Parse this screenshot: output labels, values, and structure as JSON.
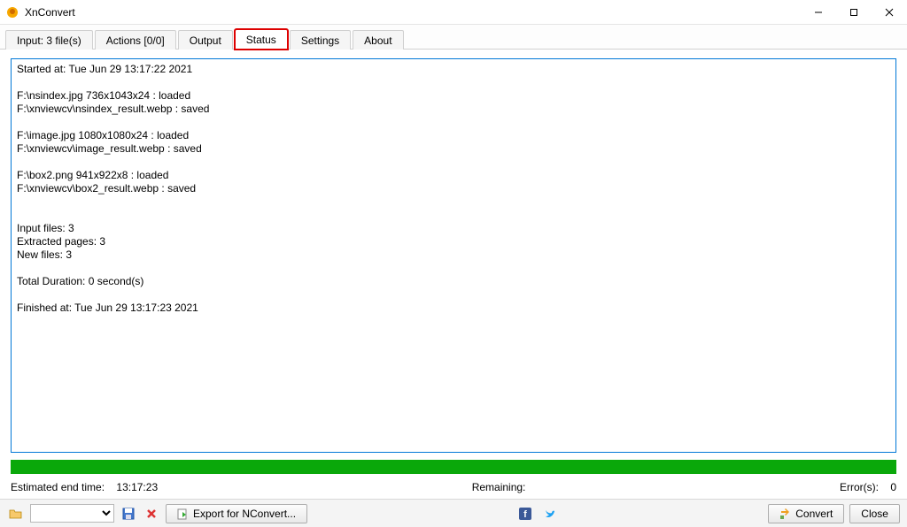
{
  "window": {
    "title": "XnConvert"
  },
  "tabs": {
    "input": "Input: 3 file(s)",
    "actions": "Actions [0/0]",
    "output": "Output",
    "status": "Status",
    "settings": "Settings",
    "about": "About"
  },
  "log": {
    "text": "Started at: Tue Jun 29 13:17:22 2021\n\nF:\\nsindex.jpg 736x1043x24 : loaded\nF:\\xnviewcv\\nsindex_result.webp : saved\n\nF:\\image.jpg 1080x1080x24 : loaded\nF:\\xnviewcv\\image_result.webp : saved\n\nF:\\box2.png 941x922x8 : loaded\nF:\\xnviewcv\\box2_result.webp : saved\n\n\nInput files: 3\nExtracted pages: 3\nNew files: 3\n\nTotal Duration: 0 second(s)\n\nFinished at: Tue Jun 29 13:17:23 2021"
  },
  "status": {
    "est_label": "Estimated end time:",
    "est_value": "13:17:23",
    "remaining_label": "Remaining:",
    "errors_label": "Error(s):",
    "errors_value": "0"
  },
  "bottom": {
    "export_label": "Export for NConvert...",
    "convert_label": "Convert",
    "close_label": "Close"
  },
  "icons": {
    "app": "xnconvert-icon",
    "folder_open": "folder-open-icon",
    "save": "save-icon",
    "delete": "delete-icon",
    "export": "script-export-icon",
    "facebook": "facebook-icon",
    "twitter": "twitter-icon",
    "convert": "convert-arrows-icon"
  }
}
